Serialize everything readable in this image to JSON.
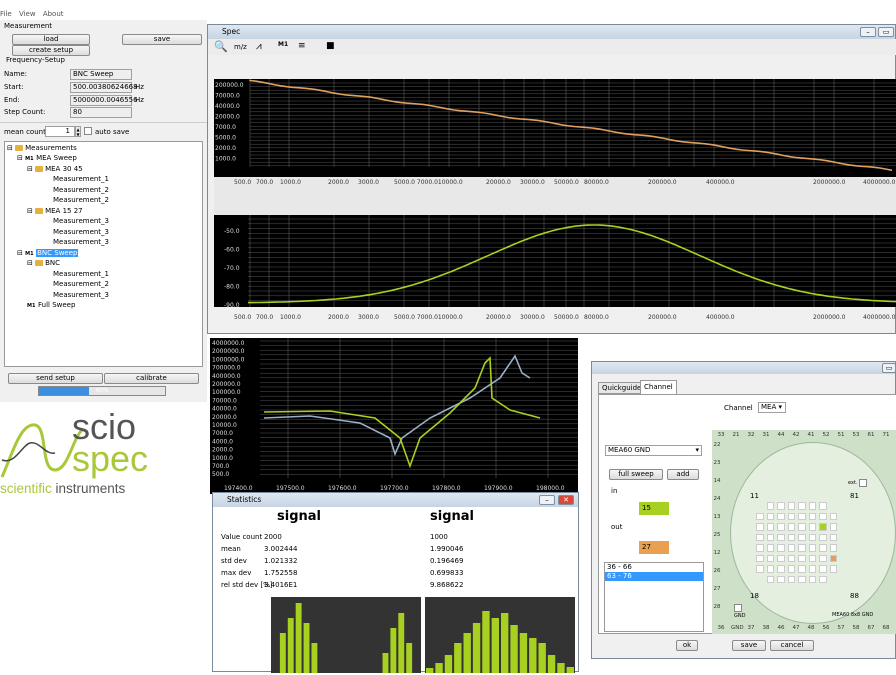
{
  "menu": {
    "file": "File",
    "view": "View",
    "about": "About"
  },
  "measurement": {
    "title": "Measurement",
    "load": "load",
    "save": "save",
    "create_setup": "create setup",
    "freq_setup": "Frequency-Setup",
    "name_label": "Name:",
    "name_value": "BNC Sweep",
    "start_label": "Start:",
    "start_value": "500.00380624668",
    "start_unit": "Hz",
    "end_label": "End:",
    "end_value": "5000000.0046556",
    "end_unit": "Hz",
    "step_label": "Step Count:",
    "step_value": "80",
    "mean_label": "mean count",
    "mean_value": "1",
    "auto_save": "auto save"
  },
  "tree": {
    "root": "Measurements",
    "mea3045": "MEA 30 45",
    "m1": "Measurement_1",
    "m2": "Measurement_2",
    "mea1527": "MEA 15 27",
    "m3": "Measurement_3",
    "bncsweep": "BNC Sweep",
    "bnc": "BNC",
    "full": "Full Sweep"
  },
  "bottom": {
    "send": "send setup",
    "calibrate": "calibrate",
    "progress_text": "40%",
    "progress": 0.4
  },
  "logo": {
    "scio": "scio",
    "spec": "spec",
    "tagline_a": "scientific",
    "tagline_b": " instruments"
  },
  "spec": {
    "title": "Spec",
    "mz": "m/z",
    "m1": "M1",
    "plot1_y": [
      "200000.0",
      "70000.0",
      "40000.0",
      "20000.0",
      "7000.0",
      "5000.0",
      "2000.0",
      "1000.0"
    ],
    "plot1_x": [
      "500.0",
      "700.0",
      "1000.0",
      "2000.0",
      "3000.0",
      "5000.0 7000.010000.0",
      "20000.0",
      "30000.0",
      "50000.0",
      "80000.0",
      "200000.0",
      "400000.0",
      "2000000.0",
      "4000000.0"
    ],
    "plot2_y": [
      "-50.0",
      "-60.0",
      "-70.0",
      "-80.0",
      "-90.0"
    ],
    "plot2_x": [
      "500.0",
      "700.0",
      "1000.0",
      "2000.0",
      "3000.0",
      "5000.0 7000.010000.0",
      "20000.0",
      "30000.0",
      "50000.0",
      "80000.0",
      "200000.0",
      "400000.0",
      "2000000.0",
      "4000000.0"
    ]
  },
  "plot3": {
    "y": [
      "4000000.0",
      "2000000.0",
      "1000000.0",
      "700000.0",
      "400000.0",
      "200000.0",
      "100000.0",
      "70000.0",
      "40000.0",
      "20000.0",
      "10000.0",
      "7000.0",
      "4000.0",
      "2000.0",
      "1000.0",
      "700.0",
      "500.0"
    ],
    "x": [
      "197400.0",
      "197500.0",
      "197600.0",
      "197700.0",
      "197800.0",
      "197900.0",
      "198000.0"
    ]
  },
  "stats": {
    "title": "Statistics",
    "col1": "signal",
    "col2": "signal",
    "rows": [
      {
        "k": "Value count",
        "a": "2000",
        "b": "1000"
      },
      {
        "k": "mean",
        "a": "3.002444",
        "b": "1.990046"
      },
      {
        "k": "std dev",
        "a": "1.021332",
        "b": "0.196469"
      },
      {
        "k": "max dev",
        "a": "1.752558",
        "b": "0.699833"
      },
      {
        "k": "rel std dev [%]",
        "a": "3.4016E1",
        "b": "9.868622"
      }
    ]
  },
  "channel": {
    "tab1": "Quickguide",
    "tab2": "Channel",
    "channel_label": "Channel",
    "channel_value": "MEA",
    "mea_select": "MEA60 GND",
    "full_sweep": "full sweep",
    "add": "add",
    "in_label": "in",
    "in_value": "15",
    "out_label": "out",
    "out_value": "27",
    "list": [
      "36 - 66",
      "63 - 76"
    ],
    "ok": "ok",
    "save": "save",
    "cancel": "cancel",
    "top_pins": [
      "33",
      "21",
      "32",
      "31",
      "44",
      "42",
      "41",
      "52",
      "51",
      "53",
      "61",
      "71"
    ],
    "left_pins": [
      "22",
      "23",
      "14",
      "24",
      "13",
      "25",
      "12",
      "26",
      "27",
      "28"
    ],
    "bottom_pins": [
      "36",
      "GND",
      "37",
      "38",
      "46",
      "47",
      "48",
      "56",
      "57",
      "58",
      "67",
      "68"
    ],
    "label11": "11",
    "label81": "81",
    "label18": "18",
    "label88": "88",
    "gnd": "GND",
    "ext": "ext.",
    "board": "MEA60 8x8 GND"
  },
  "colors": {
    "accent": "#a8d020",
    "orange": "#e0a060",
    "selection": "#3399ff"
  }
}
